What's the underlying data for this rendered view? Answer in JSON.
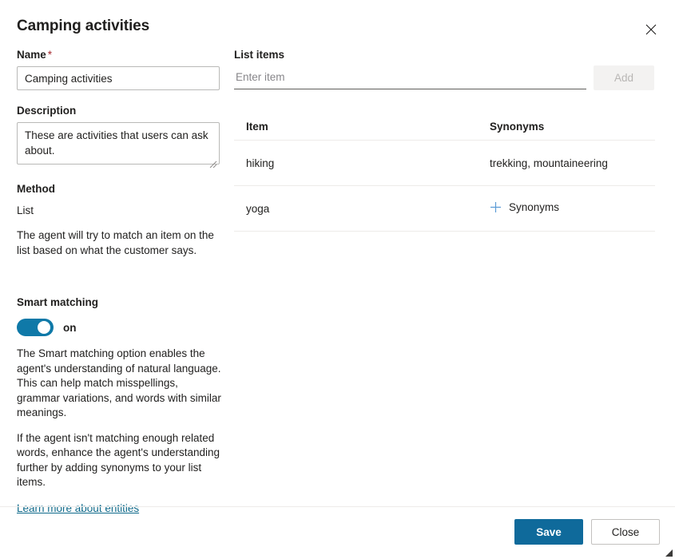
{
  "dialog": {
    "title": "Camping activities",
    "close_icon": "close-icon"
  },
  "left": {
    "name_label": "Name",
    "name_required_mark": "*",
    "name_value": "Camping activities",
    "description_label": "Description",
    "description_value": "These are activities that users can ask about.",
    "method_label": "Method",
    "method_value": "List",
    "method_help": "The agent will try to match an item on the list based on what the customer says.",
    "smart_matching_label": "Smart matching",
    "smart_matching_state": "on",
    "smart_help_1": "The Smart matching option enables the agent's understanding of natural language. This can help match misspellings, grammar variations, and words with similar meanings.",
    "smart_help_2": "If the agent isn't matching enough related words, enhance the agent's understanding further by adding synonyms to your list items.",
    "learn_more_link": "Learn more about entities"
  },
  "right": {
    "list_items_label": "List items",
    "item_input_placeholder": "Enter item",
    "item_input_value": "",
    "add_button_label": "Add",
    "table": {
      "columns": [
        "Item",
        "Synonyms"
      ],
      "rows": [
        {
          "item": "hiking",
          "synonyms": "trekking, mountaineering",
          "has_synonyms": true
        },
        {
          "item": "yoga",
          "synonyms": "Synonyms",
          "has_synonyms": false
        }
      ]
    }
  },
  "footer": {
    "save_label": "Save",
    "close_label": "Close"
  },
  "colors": {
    "accent": "#0f6a9b",
    "toggle_on": "#0f79a8",
    "link": "#0f6a8b",
    "required": "#a4262c",
    "plus": "#5b9bd5",
    "divider": "#edebe9"
  }
}
